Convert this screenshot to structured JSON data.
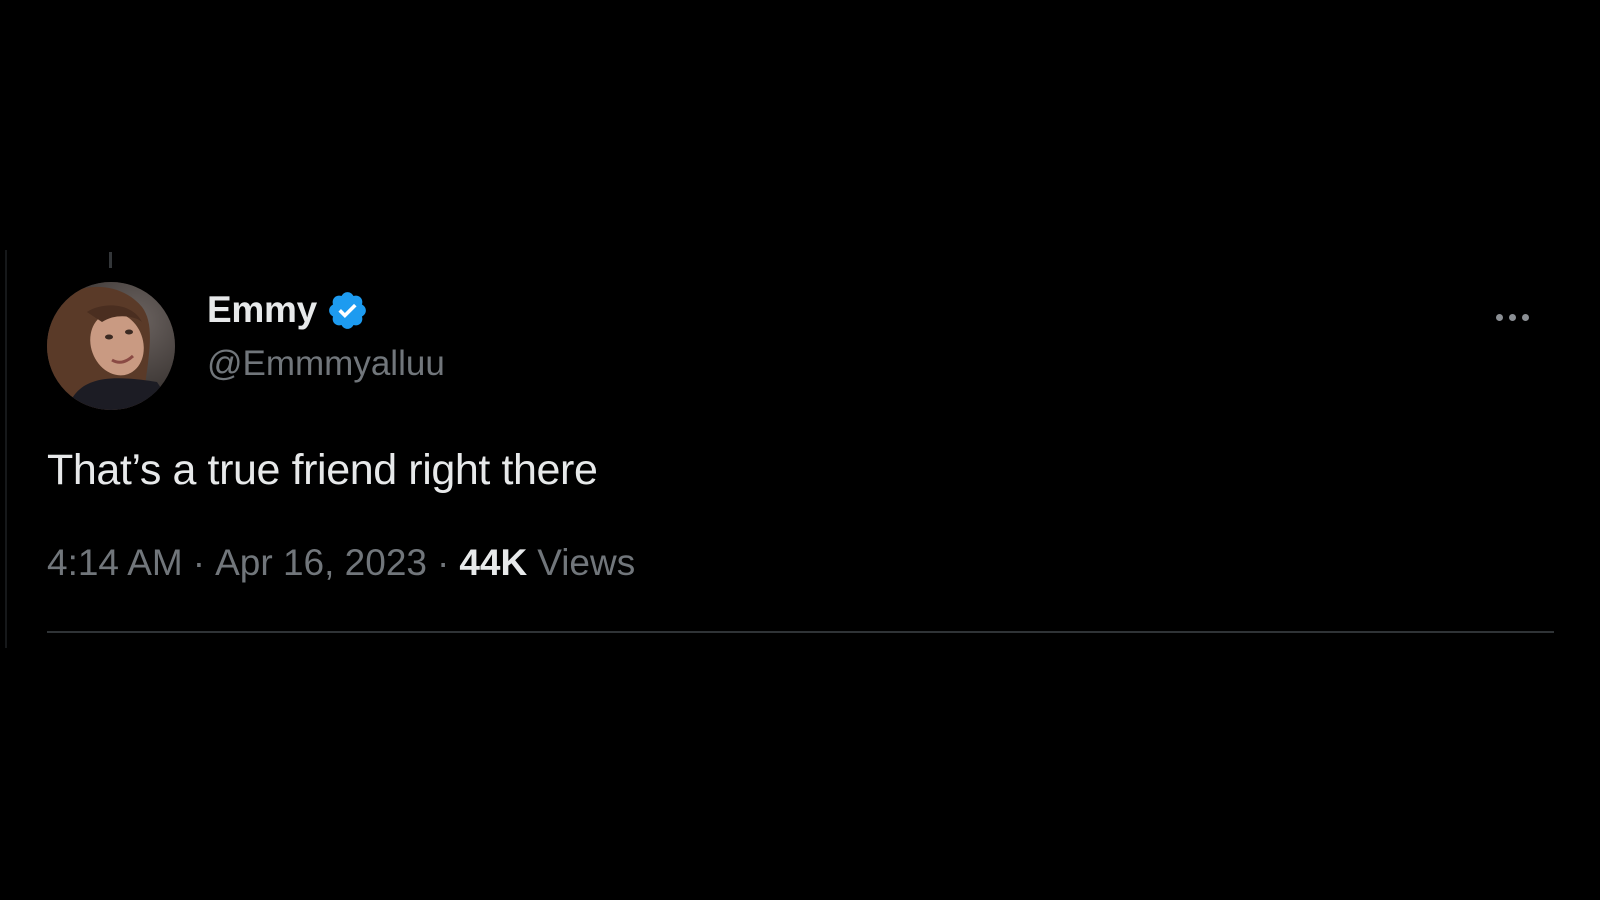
{
  "tweet": {
    "author": {
      "display_name": "Emmy",
      "handle": "@Emmmyalluu",
      "verified": true,
      "avatar_icon": "avatar-photo"
    },
    "text": "That’s a true friend right there",
    "time": "4:14 AM",
    "date": "Apr 16, 2023",
    "separator": "·",
    "views_count": "44K",
    "views_label": "Views",
    "more_icon": "ellipsis-icon"
  },
  "colors": {
    "background": "#000000",
    "primary_text": "#e7e9ea",
    "secondary_text": "#71767b",
    "verified_blue": "#1d9bf0",
    "divider": "#2f3336"
  }
}
